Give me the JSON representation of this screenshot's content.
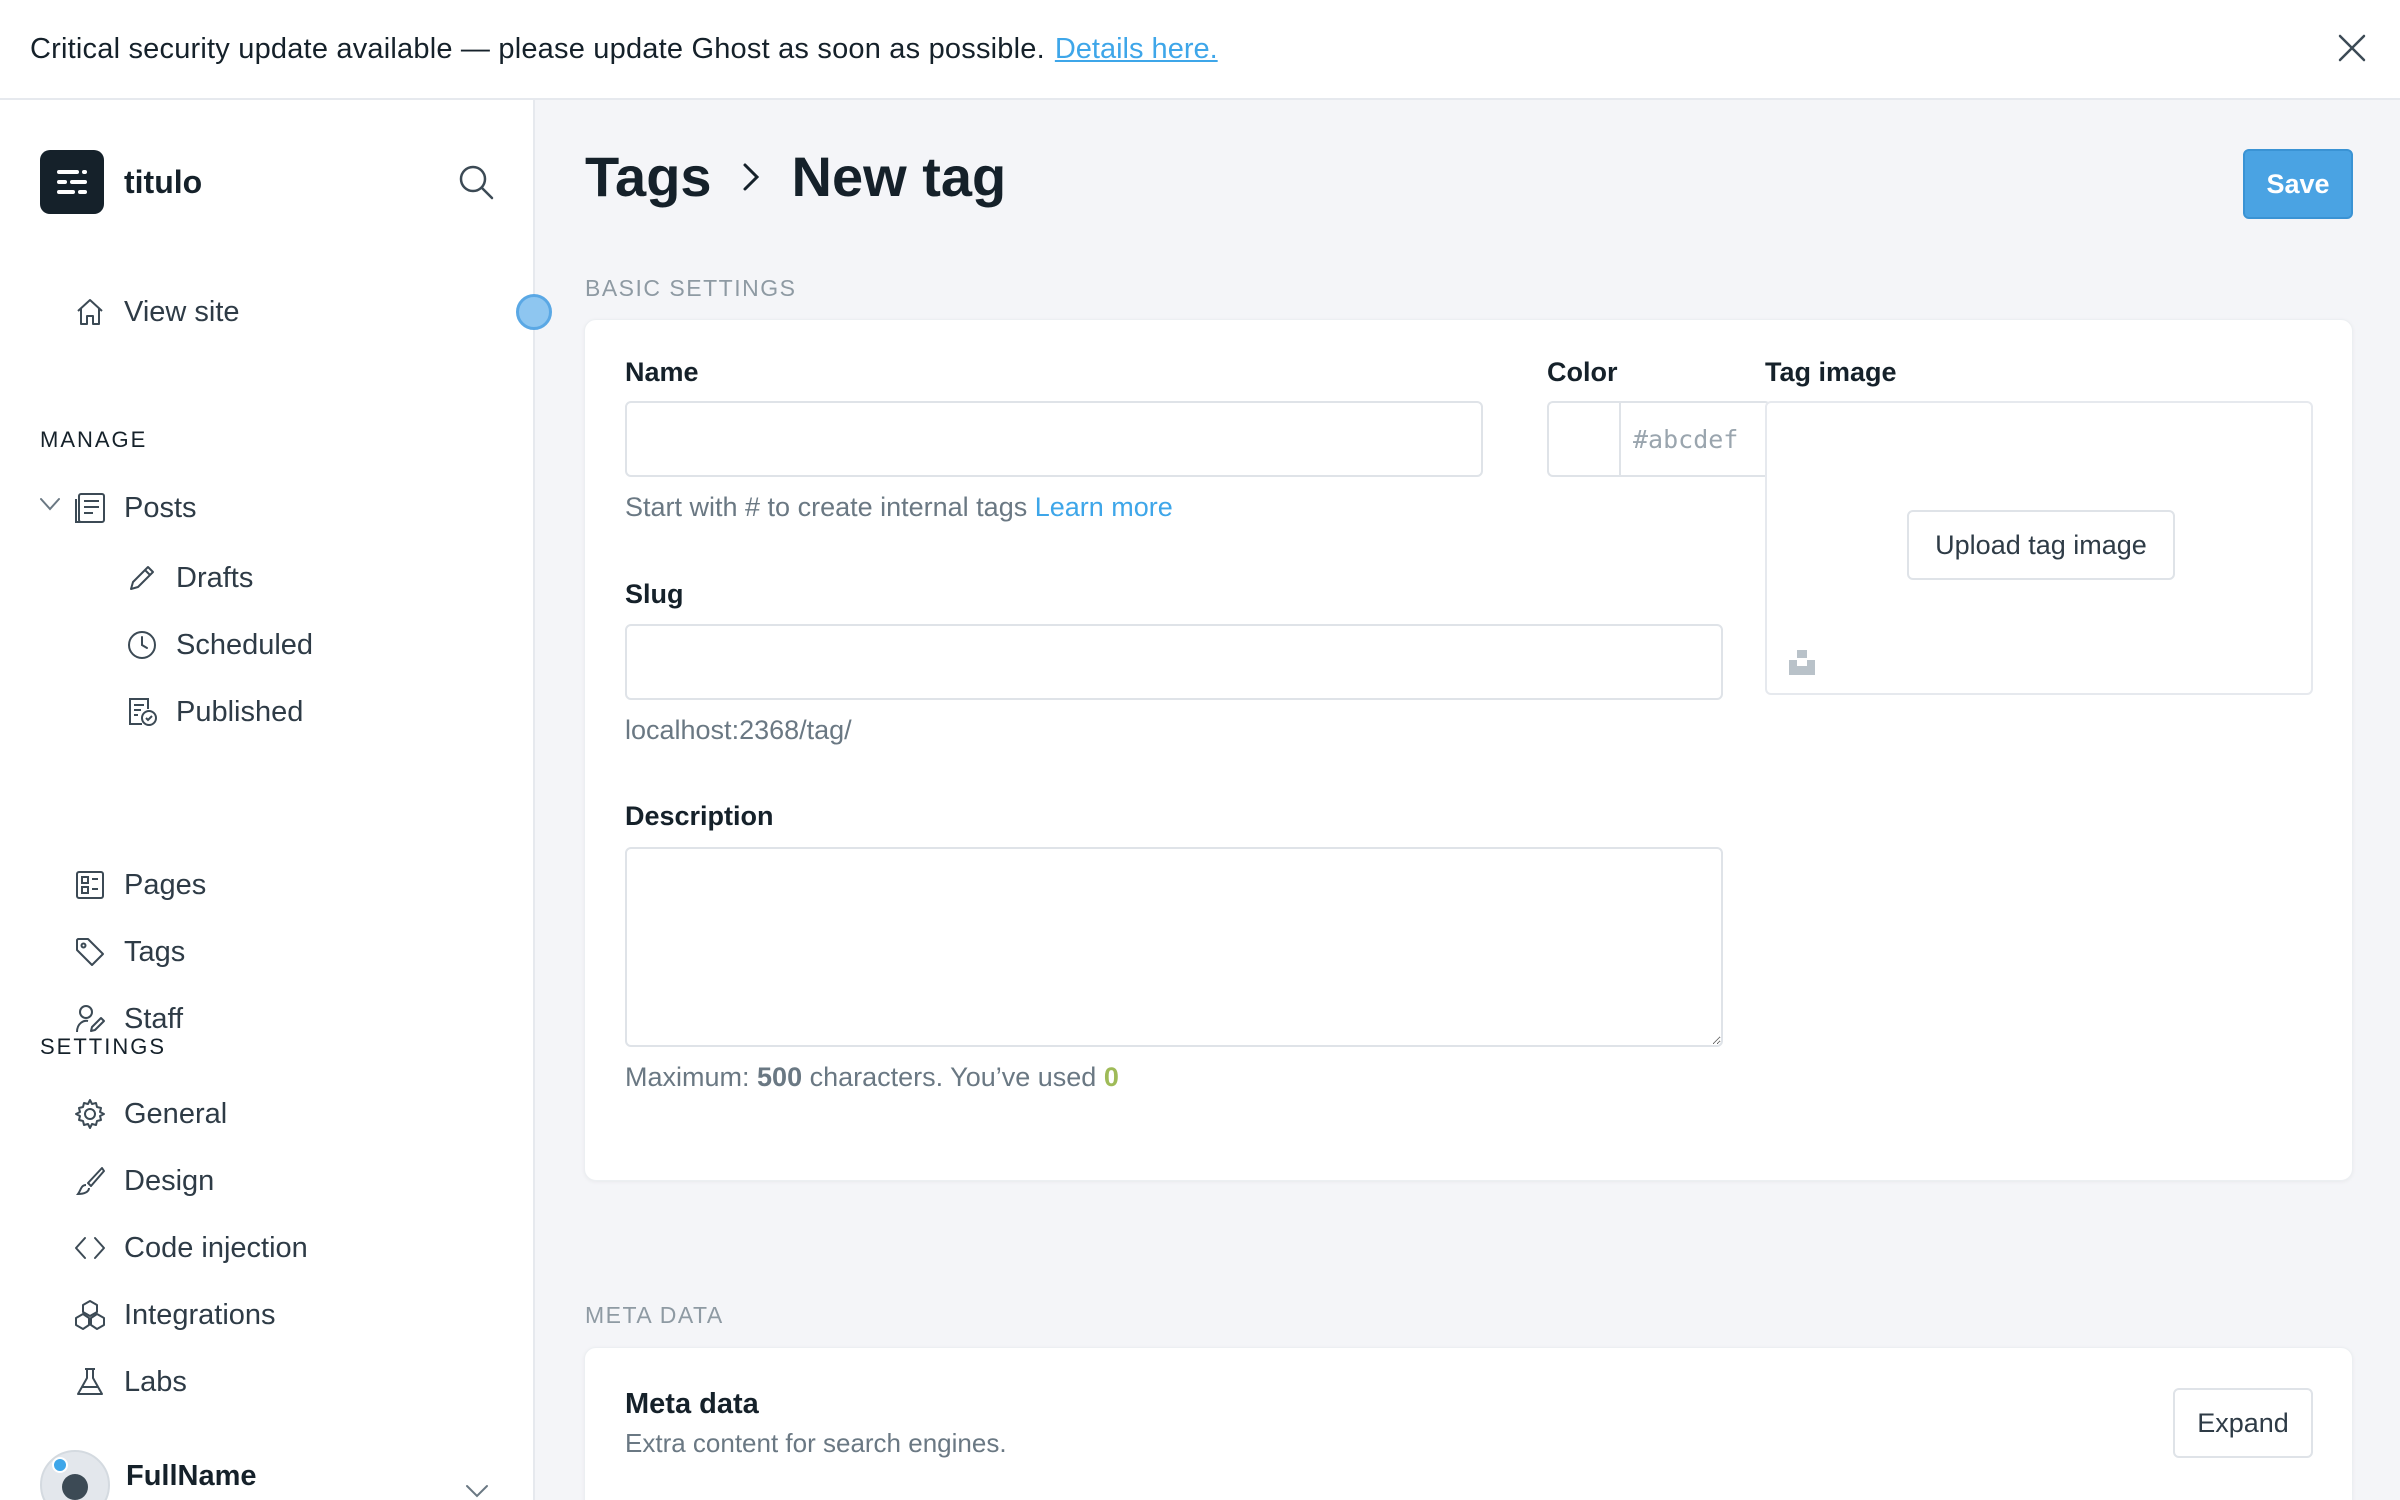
{
  "banner": {
    "message": "Critical security update available — please update Ghost as soon as possible.",
    "link_label": "Details here."
  },
  "sidebar": {
    "site_title": "titulo",
    "view_site_label": "View site",
    "manage_heading": "MANAGE",
    "settings_heading": "SETTINGS",
    "manage_items": [
      {
        "label": "Posts",
        "icon": "posts-icon"
      },
      {
        "label": "Drafts",
        "icon": "pencil-icon"
      },
      {
        "label": "Scheduled",
        "icon": "clock-icon"
      },
      {
        "label": "Published",
        "icon": "published-icon"
      },
      {
        "label": "Pages",
        "icon": "pages-icon"
      },
      {
        "label": "Tags",
        "icon": "tag-icon"
      },
      {
        "label": "Staff",
        "icon": "staff-icon"
      }
    ],
    "settings_items": [
      {
        "label": "General",
        "icon": "gear-icon"
      },
      {
        "label": "Design",
        "icon": "brush-icon"
      },
      {
        "label": "Code injection",
        "icon": "code-icon"
      },
      {
        "label": "Integrations",
        "icon": "integrations-icon"
      },
      {
        "label": "Labs",
        "icon": "flask-icon"
      }
    ],
    "user_name": "FullName"
  },
  "header": {
    "parent_crumb": "Tags",
    "current_crumb": "New tag",
    "save_label": "Save"
  },
  "basic_settings": {
    "section_label": "BASIC SETTINGS",
    "name_label": "Name",
    "name_value": "",
    "name_hint": "Start with # to create internal tags",
    "name_hint_link": "Learn more",
    "color_label": "Color",
    "color_placeholder": "#abcdef",
    "tag_image_label": "Tag image",
    "upload_label": "Upload tag image",
    "slug_label": "Slug",
    "slug_value": "",
    "slug_url": "localhost:2368/tag/",
    "description_label": "Description",
    "description_value": "",
    "desc_hint_prefix": "Maximum:",
    "desc_max": "500",
    "desc_hint_mid": "characters. You’ve used",
    "desc_used": "0"
  },
  "meta_data": {
    "section_label": "META DATA",
    "title": "Meta data",
    "subtitle": "Extra content for search engines.",
    "expand_label": "Expand"
  },
  "colors": {
    "accent": "#3ea6e9",
    "save_button": "#4aa3e3",
    "count_green": "#9fbb58",
    "dark": "#15212a"
  }
}
